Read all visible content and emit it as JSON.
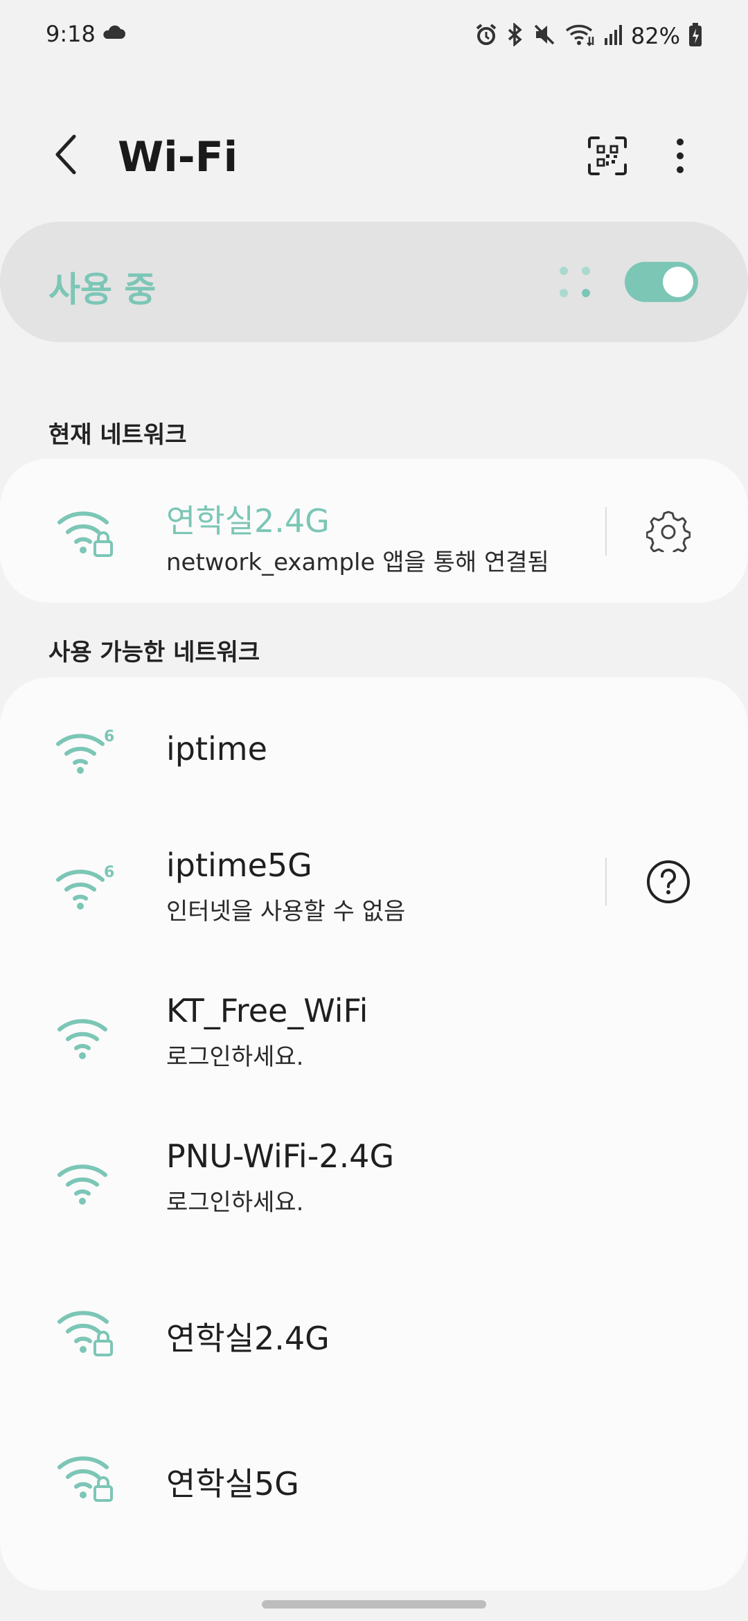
{
  "status_bar": {
    "time": "9:18",
    "battery": "82%",
    "icons": [
      "cloud-icon",
      "alarm-icon",
      "bluetooth-icon",
      "mute-icon",
      "wifi-status-icon",
      "signal-icon",
      "battery-icon"
    ]
  },
  "header": {
    "title": "Wi-Fi",
    "icons": [
      "back-icon",
      "qr-code-icon",
      "more-options-icon"
    ]
  },
  "master": {
    "label": "사용 중",
    "toggle_on": true
  },
  "current": {
    "section_title": "현재 네트워크",
    "network": {
      "name": "연학실2.4G",
      "status": "network_example 앱을 통해 연결됨"
    }
  },
  "available": {
    "section_title": "사용 가능한 네트워크",
    "networks": [
      {
        "name": "iptime",
        "sub": ""
      },
      {
        "name": "iptime5G",
        "sub": "인터넷을 사용할 수 없음"
      },
      {
        "name": "KT_Free_WiFi",
        "sub": "로그인하세요."
      },
      {
        "name": "PNU-WiFi-2.4G",
        "sub": "로그인하세요."
      },
      {
        "name": "연학실2.4G",
        "sub": ""
      },
      {
        "name": "연학실5G",
        "sub": ""
      }
    ]
  },
  "colors": {
    "accent": "#7cc6b6",
    "background": "#f2f2f2",
    "card": "#fbfbfb",
    "master_bar": "#e3e3e3"
  }
}
